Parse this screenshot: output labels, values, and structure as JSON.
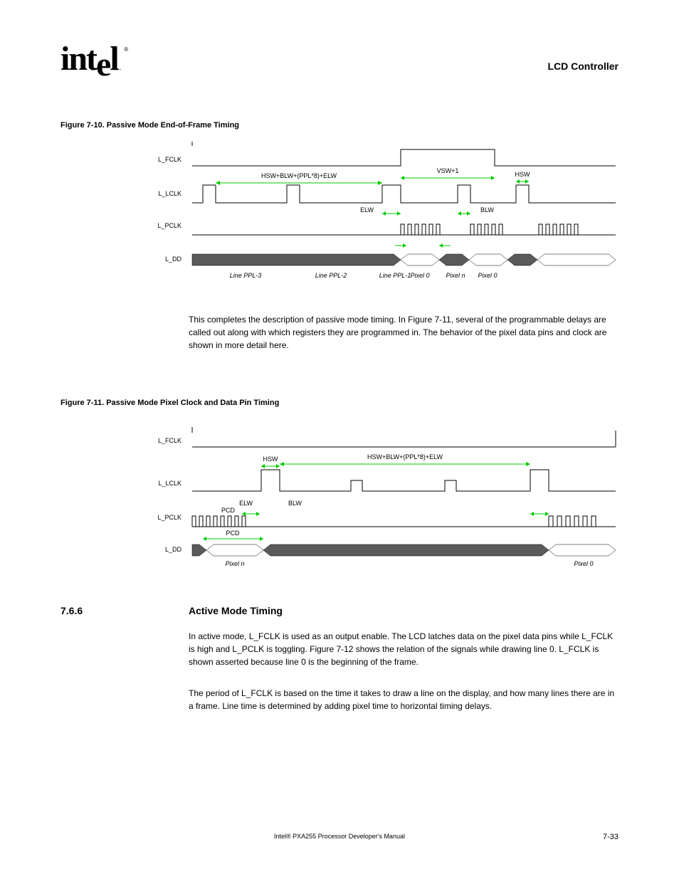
{
  "header": {
    "logo_text": "intel",
    "logo_r": "®",
    "title_right": "LCD Controller"
  },
  "fig10": {
    "caption": "Figure 7-10. Passive Mode End-of-Frame Timing",
    "signals": {
      "lfclk": "L_FCLK",
      "lclk": "L_LCLK",
      "lpclk": "L_PCLK",
      "ldd": "L_DD"
    },
    "labels": {
      "hsw": "HSW",
      "elw": "ELW",
      "blw": "BLW",
      "line_ppl3": "Line PPL-3",
      "line_ppl1": "Line PPL-1",
      "line_ppl2": "Line PPL-2",
      "pix0": "Pixel 0",
      "pixn": "Pixel n",
      "pix0_2": "Pixel 0",
      "vsw": "VSW+1",
      "meas1": "HSW+BLW+(PPL*8)+ELW"
    }
  },
  "fig11": {
    "caption": "Figure 7-11. Passive Mode Pixel Clock and Data Pin Timing",
    "signals": {
      "lfclk": "L_FCLK",
      "lclk": "L_LCLK",
      "lpclk": "L_PCLK",
      "ldd": "L_DD"
    },
    "labels": {
      "hsw": "HSW",
      "blw": "BLW",
      "elw": "ELW",
      "pcd": "PCD",
      "pcd2": "PCD",
      "pixn": "Pixel n",
      "pix0": "Pixel 0",
      "meas1": "HSW+BLW+(PPL*8)+ELW"
    }
  },
  "body1": "This completes the description of passive mode timing. In Figure 7-11, several of the programmable delays are called out along with which registers they are programmed in. The behavior of the pixel data pins and clock are shown in more detail here.",
  "body2a": "In active mode, L_FCLK is used as an output enable. The LCD latches data on the pixel data pins while L_FCLK is high and L_PCLK is toggling. Figure 7-12 shows the relation of the signals while drawing line 0. L_FCLK is shown asserted because line 0 is the beginning of the frame.",
  "body2b": "The period of L_FCLK is based on the time it takes to draw a line on the display, and how many lines there are in a frame. Line time is determined by adding pixel time to horizontal timing delays.",
  "section": {
    "num": "7.6.6",
    "title": "Active Mode Timing"
  },
  "footer": {
    "center": "Intel® PXA255 Processor Developer's Manual",
    "right": "7-33"
  },
  "chart_data": [
    {
      "type": "timing-diagram",
      "title": "Figure 7-10. Passive Mode End-of-Frame Timing",
      "signals": [
        "L_FCLK",
        "L_LCLK",
        "L_PCLK",
        "L_DD"
      ],
      "annotations": [
        "HSW+BLW+(PPL*8)+ELW",
        "VSW+1",
        "HSW",
        "ELW",
        "BLW"
      ],
      "data_labels": [
        "Line PPL-3",
        "Line PPL-2",
        "Line PPL-1",
        "Pixel 0",
        "Pixel n",
        "Pixel 0"
      ]
    },
    {
      "type": "timing-diagram",
      "title": "Figure 7-11. Passive Mode Pixel Clock and Data Pin Timing",
      "signals": [
        "L_FCLK",
        "L_LCLK",
        "L_PCLK",
        "L_DD"
      ],
      "annotations": [
        "HSW+BLW+(PPL*8)+ELW",
        "PCD",
        "HSW",
        "BLW",
        "ELW"
      ],
      "data_labels": [
        "Pixel n",
        "Pixel 0"
      ]
    }
  ]
}
